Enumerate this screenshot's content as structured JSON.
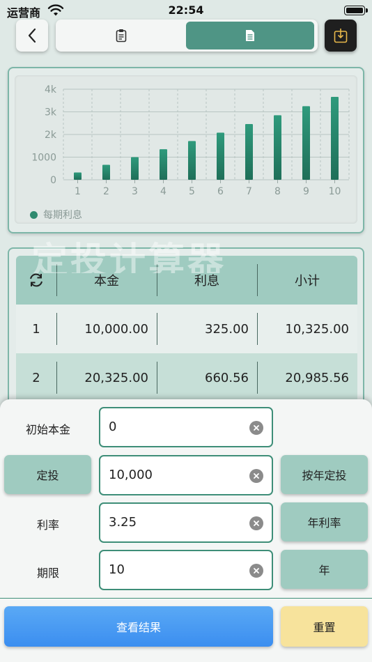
{
  "status_bar": {
    "carrier": "运营商",
    "time": "22:54"
  },
  "nav": {
    "tabs": [
      {
        "icon": "clipboard-icon",
        "selected": false
      },
      {
        "icon": "document-icon",
        "selected": true
      }
    ],
    "accent_color": "#4f9585"
  },
  "chart_data": {
    "type": "bar",
    "categories": [
      "1",
      "2",
      "3",
      "4",
      "5",
      "6",
      "7",
      "8",
      "9",
      "10"
    ],
    "series": [
      {
        "name": "每期利息",
        "values": [
          325,
          660.56,
          1000,
          1350,
          1710,
          2080,
          2460,
          2850,
          3250,
          3660
        ],
        "color": "#2f8a6f"
      }
    ],
    "yticks": [
      "0",
      "1000",
      "2k",
      "3k",
      "4k"
    ],
    "ylim": [
      0,
      4000
    ],
    "grid": true,
    "legend_position": "bottom-left"
  },
  "watermark": "定投计算器",
  "table": {
    "header_icon": "refresh-icon",
    "columns": [
      "本金",
      "利息",
      "小计"
    ],
    "rows": [
      {
        "index": "1",
        "principal": "10,000.00",
        "interest": "325.00",
        "subtotal": "10,325.00"
      },
      {
        "index": "2",
        "principal": "20,325.00",
        "interest": "660.56",
        "subtotal": "20,985.56"
      }
    ]
  },
  "form": {
    "initial_principal": {
      "label": "初始本金",
      "value": "0"
    },
    "fixed_amount": {
      "button": "定投",
      "value": "10,000",
      "mode_button": "按年定投"
    },
    "rate": {
      "label": "利率",
      "value": "3.25",
      "mode_button": "年利率"
    },
    "period": {
      "label": "期限",
      "value": "10",
      "unit_button": "年"
    }
  },
  "actions": {
    "view_result": "查看结果",
    "reset": "重置"
  }
}
